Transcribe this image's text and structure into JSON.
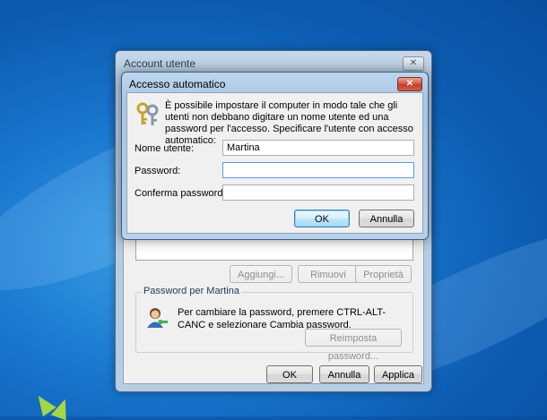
{
  "account_window": {
    "title": "Account utente",
    "close_label": "✕",
    "buttons": {
      "add": "Aggiungi...",
      "remove": "Rimuovi",
      "properties": "Proprietà"
    },
    "password_group": {
      "title": "Password per Martina",
      "text": "Per cambiare la password, premere CTRL-ALT-CANC e selezionare Cambia password.",
      "reset_button": "Reimposta password..."
    },
    "footer": {
      "ok": "OK",
      "cancel": "Annulla",
      "apply": "Applica"
    }
  },
  "auto_login_dialog": {
    "title": "Accesso automatico",
    "close_label": "✕",
    "info": "È possibile impostare il computer in modo tale che gli utenti non debbano digitare un nome utente ed una password per l'accesso. Specificare l'utente con accesso automatico:",
    "fields": {
      "username": {
        "label": "Nome utente:",
        "value": "Martina"
      },
      "password": {
        "label": "Password:",
        "value": ""
      },
      "confirm": {
        "label": "Conferma password:",
        "value": ""
      }
    },
    "ok": "OK",
    "cancel": "Annulla"
  }
}
